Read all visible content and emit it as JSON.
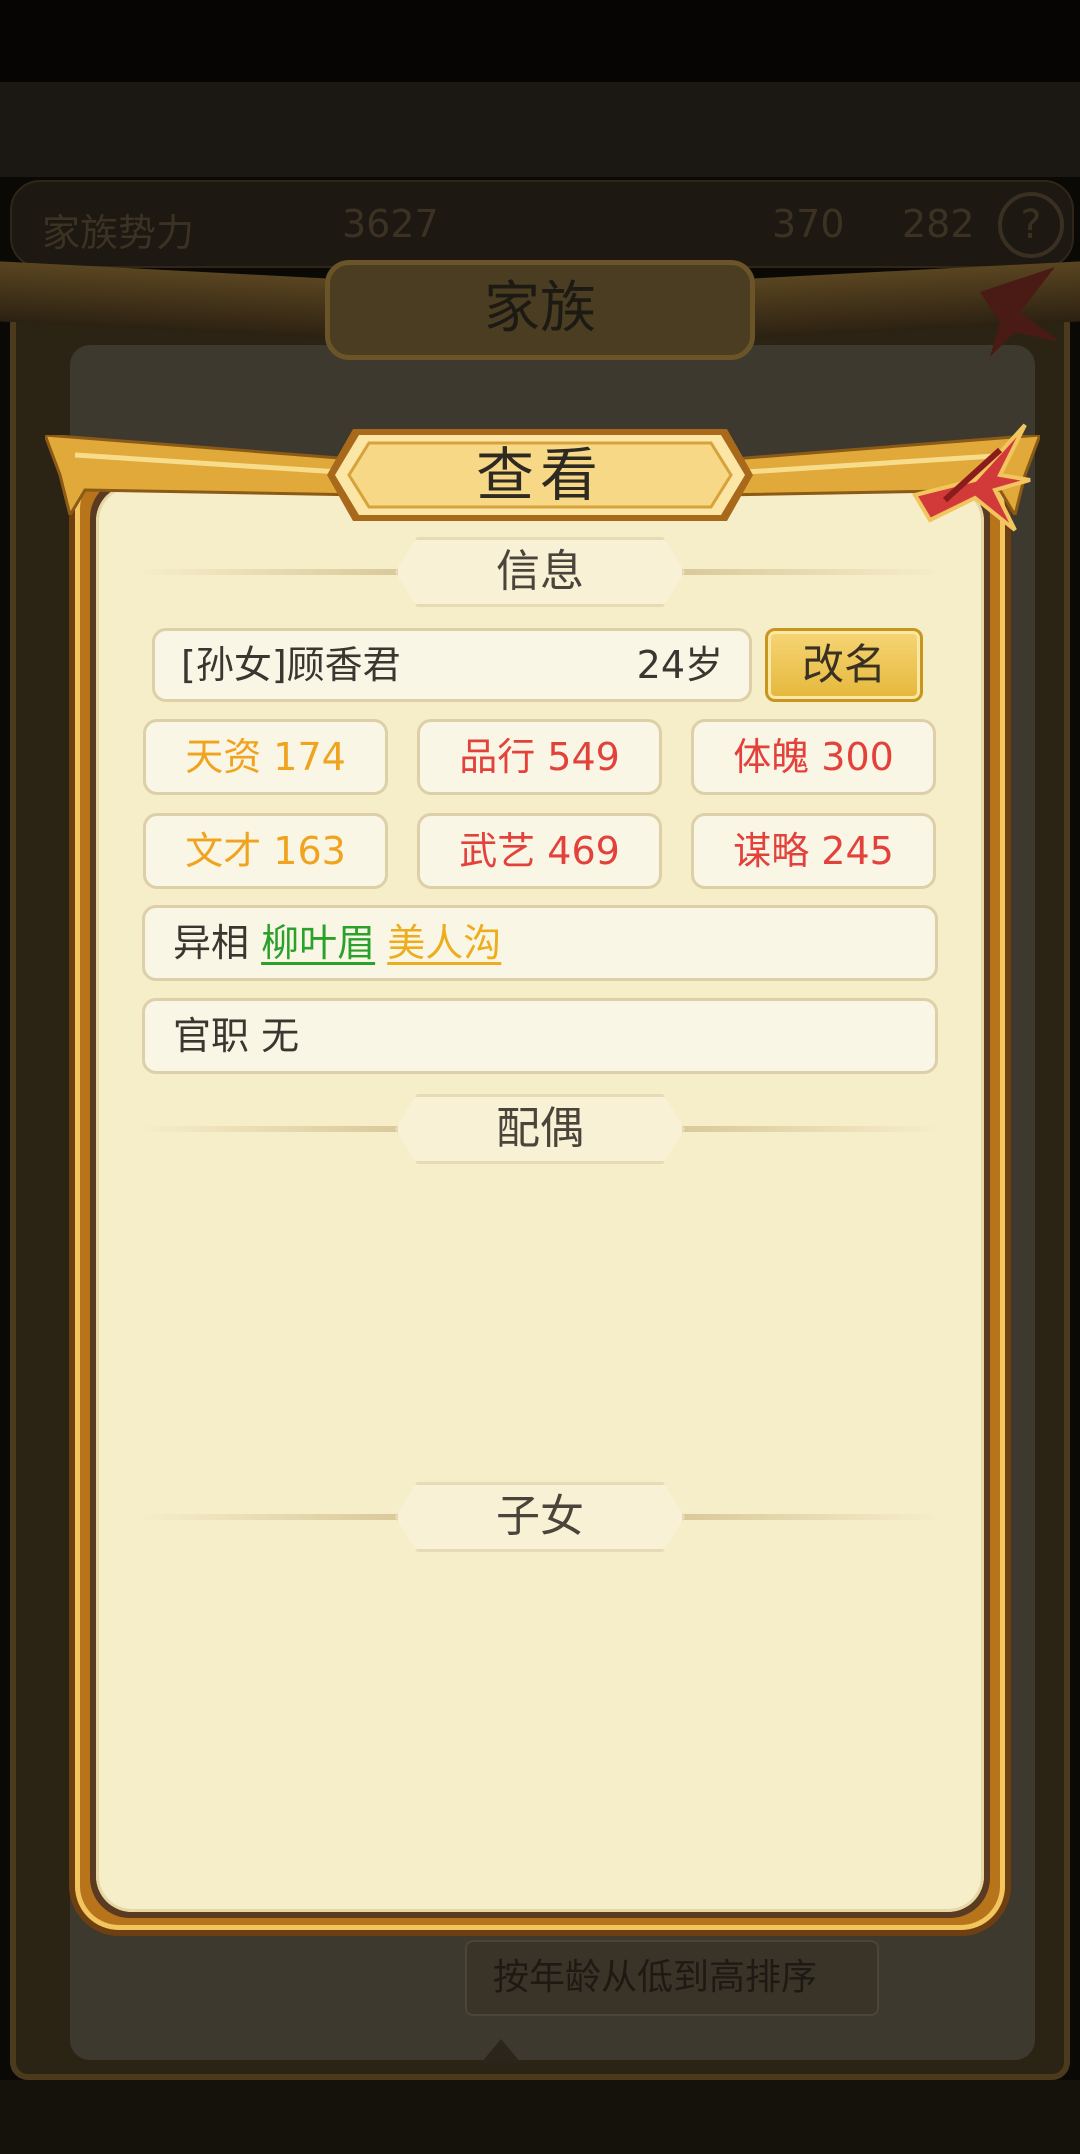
{
  "background": {
    "resource_bar": {
      "label": "家族势力",
      "value_1": "3627",
      "value_2": "370",
      "value_3": "282",
      "help": "?"
    },
    "family_title": "家族",
    "sort_button": "按年龄从低到高排序"
  },
  "modal": {
    "title": "查看",
    "section_info": "信息",
    "character": {
      "name": "[孙女]顾香君",
      "age": "24岁"
    },
    "rename_label": "改名",
    "stats": [
      {
        "label": "天资 174",
        "color": "orange"
      },
      {
        "label": "品行 549",
        "color": "red"
      },
      {
        "label": "体魄 300",
        "color": "red"
      },
      {
        "label": "文才 163",
        "color": "orange"
      },
      {
        "label": "武艺 469",
        "color": "red"
      },
      {
        "label": "谋略 245",
        "color": "red"
      }
    ],
    "traits": {
      "label": "异相",
      "items": [
        "柳叶眉",
        "美人沟"
      ]
    },
    "office": {
      "label": "官职",
      "value": "无"
    },
    "section_spouse": "配偶",
    "section_children": "子女"
  },
  "colors": {
    "stat_orange": "#f0a31e",
    "stat_red": "#e3413b",
    "trait_green": "#2aa12a",
    "trait_yellow": "#ecae1f",
    "panel_bg": "#f6edc9"
  }
}
